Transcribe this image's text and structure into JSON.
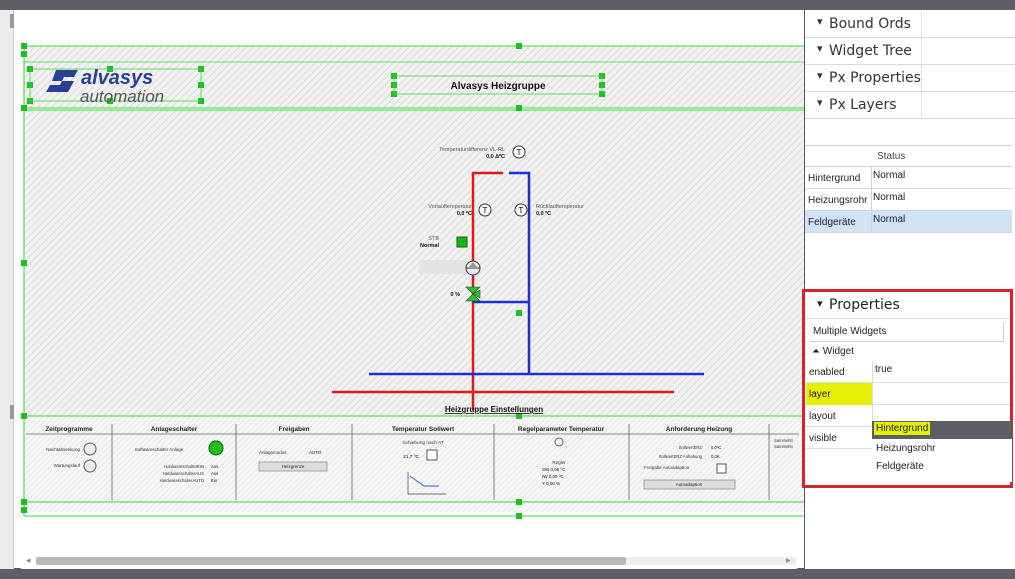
{
  "panels": {
    "bound_ords": "Bound Ords",
    "widget_tree": "Widget Tree",
    "px_properties": "Px Properties",
    "px_layers": "Px Layers"
  },
  "layers_table": {
    "header": "Status",
    "rows": [
      {
        "name": "Hintergrund",
        "status": "Normal"
      },
      {
        "name": "Heizungsrohr",
        "status": "Normal"
      },
      {
        "name": "Feldgeräte",
        "status": "Normal"
      }
    ]
  },
  "properties": {
    "title": "Properties",
    "subtitle": "Multiple Widgets",
    "group": "Widget",
    "rows": [
      {
        "key": "enabled",
        "value": "true"
      },
      {
        "key": "layer",
        "value": ""
      },
      {
        "key": "layout",
        "value": ""
      },
      {
        "key": "visible",
        "value": ""
      }
    ],
    "layer_options": [
      "Hintergrund",
      "Heizungsrohr",
      "Feldgeräte"
    ]
  },
  "canvas": {
    "logo_brand": "alvasys",
    "logo_sub": "automation",
    "page_title": "Alvasys Heizgruppe",
    "temp_diff_label": "Temperaturdifferenz VL-RL",
    "temp_diff_value": "0,0 ΔºC",
    "vorlauf_label": "Vorlauftemperatur",
    "vorlauf_value": "0,0 ºC",
    "ruecklauf_label": "Rücklauftemperatur",
    "ruecklauf_value": "0,0 ºC",
    "stb_label": "STB",
    "stb_value": "Normal",
    "valve_value": "0 %",
    "settings_title": "Heizgruppe Einstellungen",
    "sections": [
      "Zeitprogramme",
      "Anlageschalter",
      "Freigaben",
      "Temperatur Sollwert",
      "Regelparameter Temperatur",
      "Anforderung Heizung"
    ],
    "zeit_items": [
      "Nachtabsenkung",
      "Wartungslauf"
    ],
    "anlage_label": "Softwareschalter Anlage",
    "hw_rows": [
      {
        "label": "HardwareschalterEIN",
        "value": "Aus"
      },
      {
        "label": "HardwareschalterAUS",
        "value": "Aus"
      },
      {
        "label": "HardwareschalterAUTO",
        "value": "Ein"
      }
    ],
    "anlagemodus_label": "Anlagemodus",
    "anlagemodus_value": "AUTO",
    "heizgrenze_button": "Heizgrenze",
    "schiebung_label": "Schiebung nach AT",
    "sollwert_value": "21,7 ºC",
    "regler_label": "Regler",
    "sw_value": "SW  0,00 ºC",
    "iw_value": "IW  0,00 ºC",
    "y_value": "Y    0,00 %",
    "sollwert_erz": "SollwertERZ",
    "sollwert_erz_val": "0,0ºC",
    "sollwert_anh": "SollwertERZ Anhebung",
    "sollwert_anh_val": "0,0K",
    "freigabe_auto": "Freigabe Autoadaption",
    "autoadaption_button": "Autoadaption",
    "sammel_1": "Sammelst",
    "sammel_2": "Sammelst"
  }
}
